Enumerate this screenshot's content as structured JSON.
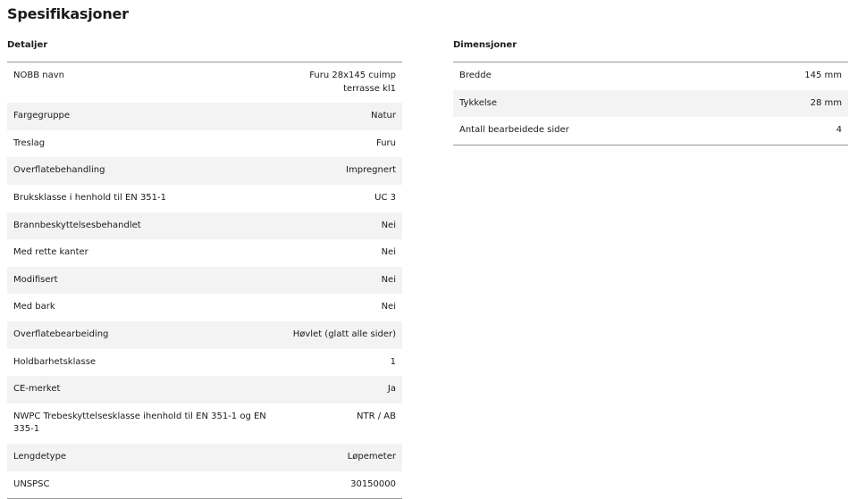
{
  "page": {
    "title": "Spesifikasjoner"
  },
  "details": {
    "heading": "Detaljer",
    "rows": [
      {
        "label": "NOBB navn",
        "value": "Furu 28x145 cuimp terrasse kl1"
      },
      {
        "label": "Fargegruppe",
        "value": "Natur"
      },
      {
        "label": "Treslag",
        "value": "Furu"
      },
      {
        "label": "Overflatebehandling",
        "value": "Impregnert"
      },
      {
        "label": "Bruksklasse i henhold til EN 351-1",
        "value": "UC 3"
      },
      {
        "label": "Brannbeskyttelsesbehandlet",
        "value": "Nei"
      },
      {
        "label": "Med rette kanter",
        "value": "Nei"
      },
      {
        "label": "Modifisert",
        "value": "Nei"
      },
      {
        "label": "Med bark",
        "value": "Nei"
      },
      {
        "label": "Overflatebearbeiding",
        "value": "Høvlet (glatt alle sider)"
      },
      {
        "label": "Holdbarhetsklasse",
        "value": "1"
      },
      {
        "label": "CE-merket",
        "value": "Ja"
      },
      {
        "label": "NWPC Trebeskyttelsesklasse ihenhold til EN 351-1 og EN 335-1",
        "value": "NTR / AB"
      },
      {
        "label": "Lengdetype",
        "value": "Løpemeter"
      },
      {
        "label": "UNSPSC",
        "value": "30150000"
      }
    ]
  },
  "dimensions": {
    "heading": "Dimensjoner",
    "rows": [
      {
        "label": "Bredde",
        "value": "145 mm"
      },
      {
        "label": "Tykkelse",
        "value": "28 mm"
      },
      {
        "label": "Antall bearbeidede sider",
        "value": "4"
      }
    ]
  }
}
